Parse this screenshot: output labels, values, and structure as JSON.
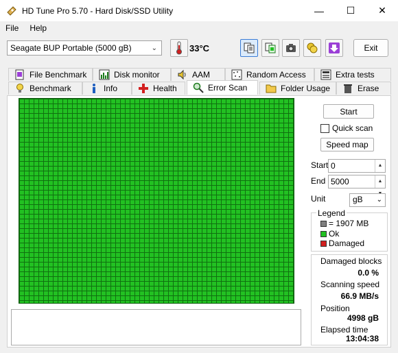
{
  "window": {
    "title": "HD Tune Pro 5.70 - Hard Disk/SSD Utility",
    "minimize": "—",
    "maximize": "☐",
    "close": "✕"
  },
  "menu": {
    "file": "File",
    "help": "Help"
  },
  "toolbar": {
    "drive": "Seagate BUP Portable (5000 gB)",
    "temperature": "33°C",
    "exit_label": "Exit"
  },
  "tabs_top": [
    {
      "label": "File Benchmark",
      "icon": "file-benchmark-icon"
    },
    {
      "label": "Disk monitor",
      "icon": "disk-monitor-icon"
    },
    {
      "label": "AAM",
      "icon": "speaker-icon"
    },
    {
      "label": "Random Access",
      "icon": "random-access-icon"
    },
    {
      "label": "Extra tests",
      "icon": "extra-tests-icon"
    }
  ],
  "tabs_bottom": [
    {
      "label": "Benchmark",
      "icon": "benchmark-icon"
    },
    {
      "label": "Info",
      "icon": "info-icon"
    },
    {
      "label": "Health",
      "icon": "health-icon"
    },
    {
      "label": "Error Scan",
      "icon": "magnifier-icon",
      "active": true
    },
    {
      "label": "Folder Usage",
      "icon": "folder-icon"
    },
    {
      "label": "Erase",
      "icon": "trash-icon"
    }
  ],
  "controls": {
    "start_button": "Start",
    "quick_scan_label": "Quick scan",
    "quick_scan_checked": false,
    "speed_map_button": "Speed map",
    "start_label": "Start",
    "start_value": "0",
    "end_label": "End",
    "end_value": "5000",
    "unit_label": "Unit",
    "unit_value": "gB"
  },
  "legend": {
    "title": "Legend",
    "items": [
      {
        "label": "= 1907 MB",
        "color": "#808080"
      },
      {
        "label": "Ok",
        "color": "#22c122"
      },
      {
        "label": "Damaged",
        "color": "#d21f1f"
      }
    ]
  },
  "stats": {
    "damaged_blocks_label": "Damaged blocks",
    "damaged_blocks_value": "0.0 %",
    "scanning_speed_label": "Scanning speed",
    "scanning_speed_value": "66.9 MB/s",
    "position_label": "Position",
    "position_value": "4998 gB",
    "elapsed_time_label": "Elapsed time",
    "elapsed_time_value": "13:04:38"
  },
  "colors": {
    "ok_block": "#22c122",
    "accent": "#3a7bd5"
  }
}
